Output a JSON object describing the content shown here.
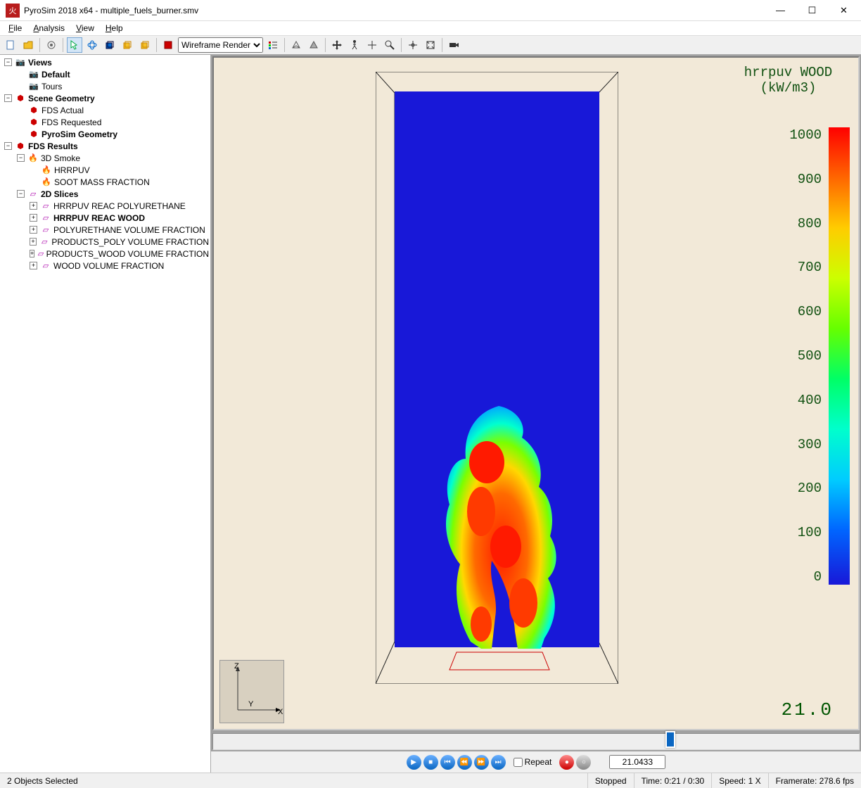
{
  "window": {
    "title": "PyroSim 2018 x64 - multiple_fuels_burner.smv",
    "app_icon_text": "火"
  },
  "menu": {
    "file": "File",
    "analysis": "Analysis",
    "view": "View",
    "help": "Help"
  },
  "toolbar": {
    "render_mode": "Wireframe Render"
  },
  "tree": {
    "views": "Views",
    "default": "Default",
    "tours": "Tours",
    "scene_geometry": "Scene Geometry",
    "fds_actual": "FDS Actual",
    "fds_requested": "FDS Requested",
    "pyrosim_geometry": "PyroSim Geometry",
    "fds_results": "FDS Results",
    "smoke3d": "3D Smoke",
    "hrrpuv": "HRRPUV",
    "soot": "SOOT MASS FRACTION",
    "slices2d": "2D Slices",
    "s1": "HRRPUV REAC POLYURETHANE",
    "s2": "HRRPUV REAC WOOD",
    "s3": "POLYURETHANE VOLUME FRACTION",
    "s4": "PRODUCTS_POLY VOLUME FRACTION",
    "s5": "PRODUCTS_WOOD VOLUME FRACTION",
    "s6": "WOOD VOLUME FRACTION"
  },
  "colorbar": {
    "title_line1": "hrrpuv WOOD",
    "title_line2": "(kW/m3)",
    "ticks": [
      "1000",
      "900",
      "800",
      "700",
      "600",
      "500",
      "400",
      "300",
      "200",
      "100",
      "0"
    ]
  },
  "time_display": "21.0",
  "playback": {
    "repeat": "Repeat",
    "time_value": "21.0433",
    "progress_percent": 70
  },
  "status": {
    "selection": "2 Objects Selected",
    "state": "Stopped",
    "time": "Time: 0:21 / 0:30",
    "speed": "Speed: 1 X",
    "framerate": "Framerate: 278.6 fps"
  },
  "axis": {
    "x": "X",
    "y": "Y",
    "z": "Z"
  },
  "chart_data": {
    "type": "heatmap",
    "title": "hrrpuv WOOD (kW/m3)",
    "colorbar_range": [
      0,
      1000
    ],
    "colorbar_unit": "kW/m3",
    "time_s": 21.0,
    "description": "2D slice of heat release rate per unit volume for WOOD reaction; flame plume concentrated in lower-center region with peak values near 1000 kW/m3, background near 0."
  }
}
